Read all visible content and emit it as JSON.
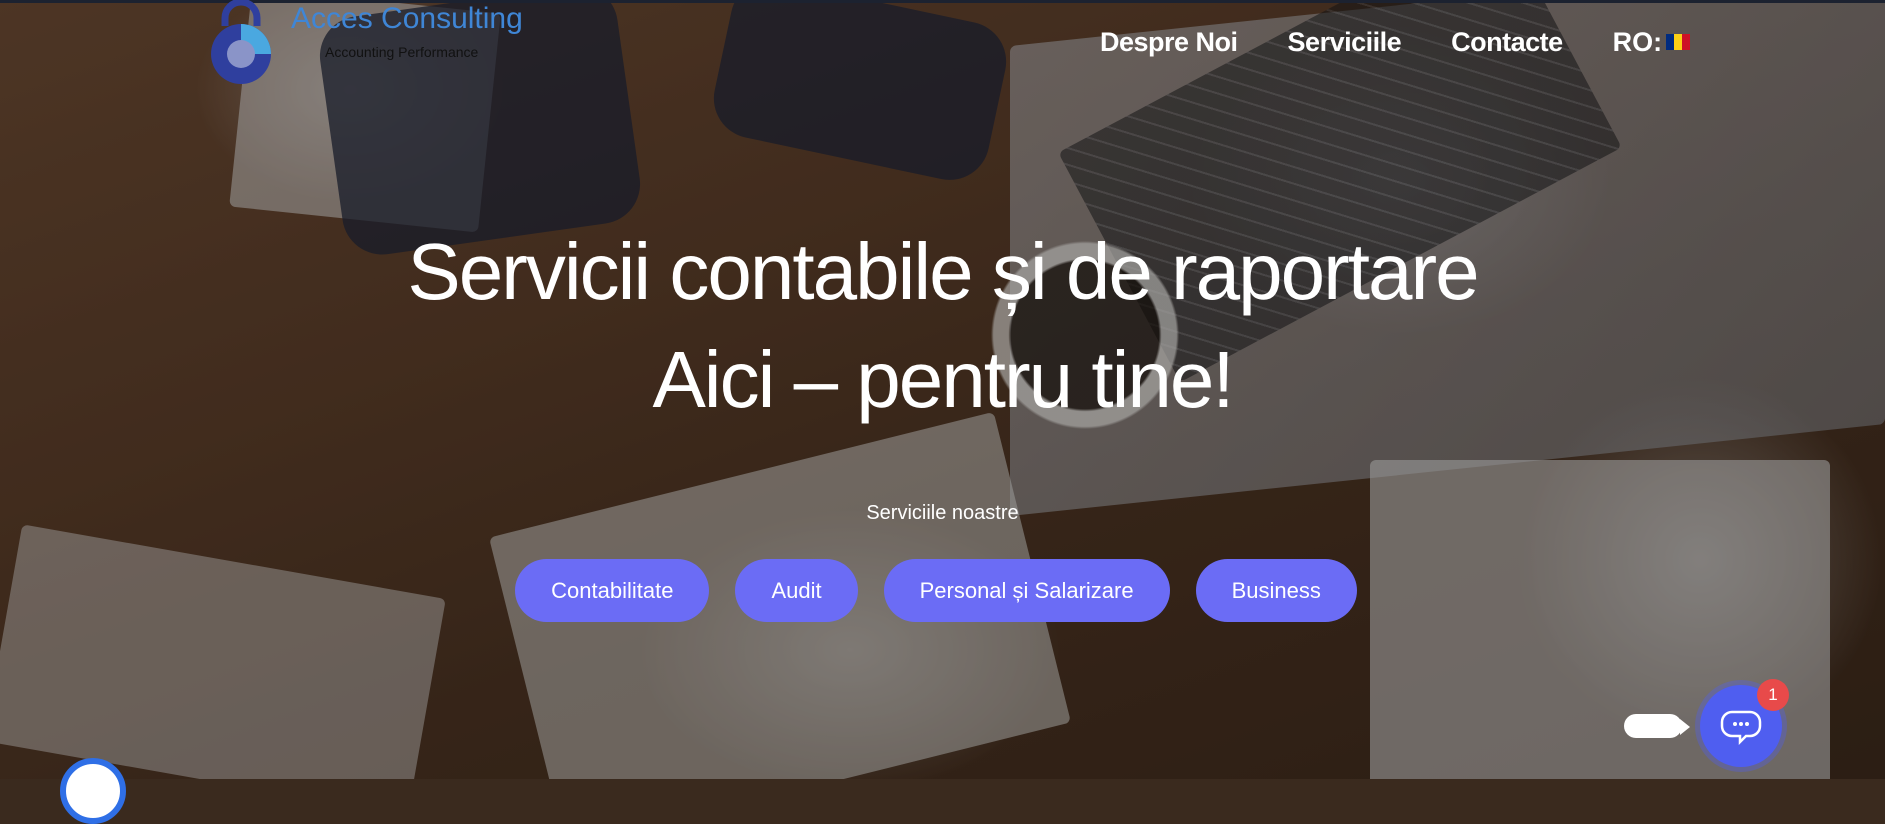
{
  "brand": {
    "name": "Acces Consulting",
    "tagline": "Accounting Performance"
  },
  "nav": {
    "items": [
      {
        "label": "Despre Noi"
      },
      {
        "label": "Serviciile"
      },
      {
        "label": "Contacte"
      }
    ],
    "language": "RO:",
    "flag_colors": [
      "#002b7f",
      "#fcd116",
      "#ce1126"
    ]
  },
  "hero": {
    "headline_line1": "Servicii contabile și de raportare",
    "headline_line2": "Aici – pentru tine!",
    "services_label": "Serviciile noastre",
    "buttons": [
      {
        "label": "Contabilitate"
      },
      {
        "label": "Audit"
      },
      {
        "label": "Personal și Salarizare"
      },
      {
        "label": "Business"
      }
    ]
  },
  "chat": {
    "badge_count": "1",
    "icon": "chat-bubbles-icon"
  },
  "colors": {
    "accent": "#6b6cf5",
    "chat": "#4f5ef0",
    "badge": "#e84a4a",
    "logo_text": "#3f86d6"
  }
}
